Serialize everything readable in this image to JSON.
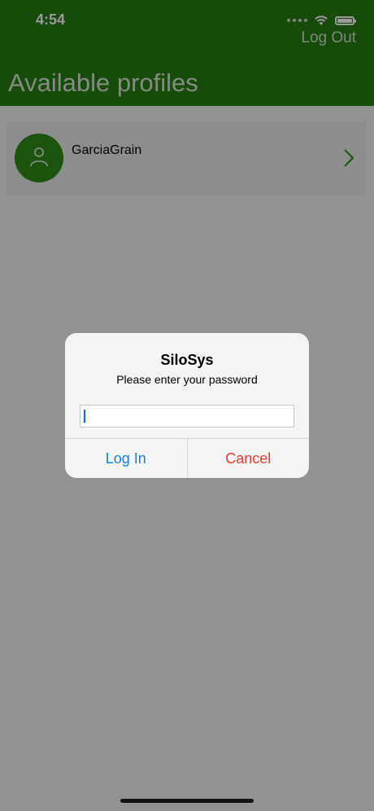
{
  "status_bar": {
    "time": "4:54"
  },
  "header": {
    "logout_label": "Log Out",
    "title": "Available profiles"
  },
  "profiles": [
    {
      "name": "GarciaGrain"
    }
  ],
  "dialog": {
    "title": "SiloSys",
    "message": "Please enter your password",
    "password_value": "",
    "login_label": "Log In",
    "cancel_label": "Cancel"
  },
  "colors": {
    "brand_green": "#267d15",
    "link_blue": "#1a7fe0",
    "destructive_red": "#e03c30"
  }
}
